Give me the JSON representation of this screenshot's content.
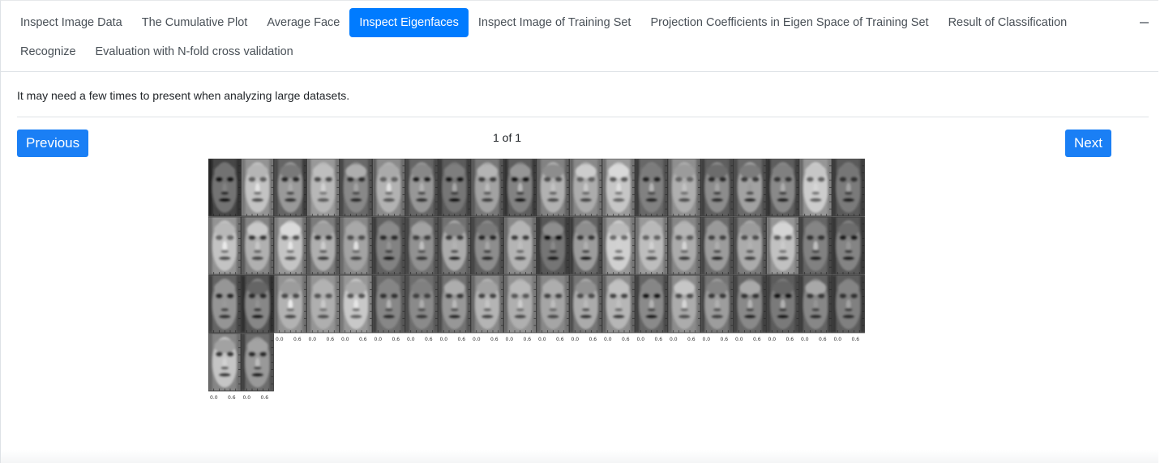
{
  "tabs": [
    {
      "label": "Inspect Image Data",
      "active": false
    },
    {
      "label": "The Cumulative Plot",
      "active": false
    },
    {
      "label": "Average Face",
      "active": false
    },
    {
      "label": "Inspect Eigenfaces",
      "active": true
    },
    {
      "label": "Inspect Image of Training Set",
      "active": false
    },
    {
      "label": "Projection Coefficients in Eigen Space of Training Set",
      "active": false
    },
    {
      "label": "Result of Classification",
      "active": false
    },
    {
      "label": "Recognize",
      "active": false
    },
    {
      "label": "Evaluation with N-fold cross validation",
      "active": false
    }
  ],
  "notice": "It may need a few times to present when analyzing large datasets.",
  "pager": {
    "previous_label": "Previous",
    "next_label": "Next",
    "page_text": "1 of 1"
  },
  "eigenfaces": {
    "rows": [
      20,
      20,
      20,
      2
    ],
    "tick_labels": [
      "0.0",
      "0.6"
    ]
  },
  "colors": {
    "accent": "#007bff"
  }
}
